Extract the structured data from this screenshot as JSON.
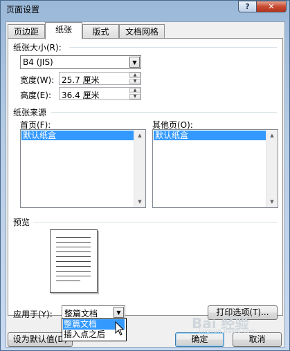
{
  "window": {
    "title": "页面设置",
    "help_glyph": "?",
    "close_glyph": "✕"
  },
  "tabs": [
    {
      "label": "页边距"
    },
    {
      "label": "纸张"
    },
    {
      "label": "版式"
    },
    {
      "label": "文档网格"
    }
  ],
  "paper_size": {
    "label": "纸张大小(R):",
    "value": "B4 (JIS)",
    "width_label": "宽度(W):",
    "width_value": "25.7 厘米",
    "height_label": "高度(E):",
    "height_value": "36.4 厘米"
  },
  "paper_source": {
    "label": "纸张来源",
    "first_page_label": "首页(F):",
    "first_page_selected": "默认纸盒",
    "other_pages_label": "其他页(O):",
    "other_pages_selected": "默认纸盒"
  },
  "preview": {
    "label": "预览"
  },
  "apply_to": {
    "label": "应用于(Y):",
    "value": "整篇文档",
    "options": [
      "整篇文档",
      "插入点之后"
    ]
  },
  "buttons": {
    "print_options": "打印选项(T)...",
    "set_default": "设为默认值(D)",
    "ok": "确定",
    "cancel": "取消"
  },
  "watermark": {
    "text": "Bai 经验",
    "sub": "jingyan.baidu.com"
  }
}
